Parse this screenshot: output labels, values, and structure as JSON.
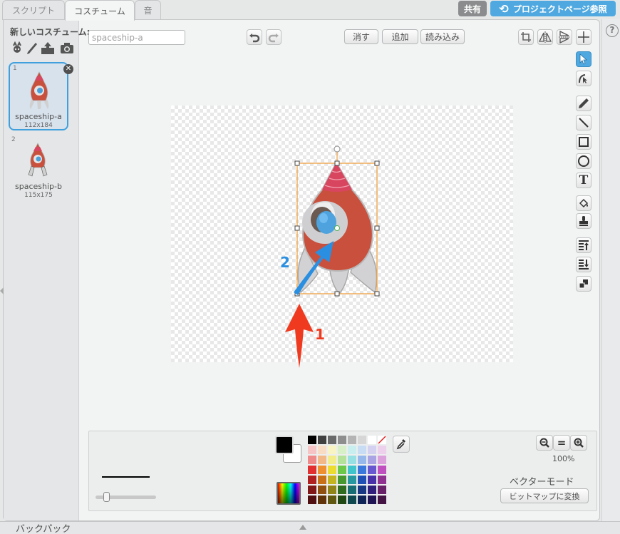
{
  "tabs": [
    {
      "label": "スクリプト"
    },
    {
      "label": "コスチューム"
    },
    {
      "label": "音"
    }
  ],
  "top_buttons": {
    "share": "共有",
    "project_page": "プロジェクトページ参照"
  },
  "sidebar": {
    "new_costume_label": "新しいコスチューム:",
    "costumes": [
      {
        "number": "1",
        "name": "spaceship-a",
        "size": "112x184"
      },
      {
        "number": "2",
        "name": "spaceship-b",
        "size": "115x175"
      }
    ]
  },
  "editor": {
    "costume_name": "spaceship-a",
    "clear_label": "消す",
    "add_label": "追加",
    "import_label": "読み込み",
    "zoom_level": "100%",
    "mode_label": "ベクターモード",
    "convert_label": "ビットマップに変換",
    "line_width_fraction": 0.15
  },
  "annotations": {
    "arrow1_label": "1",
    "arrow2_label": "2",
    "arrow1_color": "#f03a1f",
    "arrow2_color": "#2a8fe0"
  },
  "backpack_label": "バックパック",
  "help_label": "?",
  "palette_colors": [
    "#000000",
    "#404040",
    "#6a6a6a",
    "#8e8e8e",
    "#b4b4b4",
    "#d6d6d6",
    "#ffffff",
    "none",
    "#f6c4c4",
    "#f8dcc4",
    "#f8f4c4",
    "#d8f0c8",
    "#c8eef0",
    "#c8dcf4",
    "#d4d0f0",
    "#ecd0ec",
    "#ee8a8a",
    "#f2b888",
    "#f2ec8a",
    "#b4e29a",
    "#96e0e4",
    "#96b8ea",
    "#aaa4e4",
    "#dca2dc",
    "#e23030",
    "#ee9030",
    "#ecdc30",
    "#6cc848",
    "#40c4cc",
    "#3a78dc",
    "#6858d0",
    "#c050c0",
    "#b02020",
    "#c87018",
    "#c4b420",
    "#489830",
    "#2898a0",
    "#2050b4",
    "#4830a8",
    "#903090",
    "#801818",
    "#905010",
    "#908418",
    "#306c20",
    "#186c74",
    "#183884",
    "#30207c",
    "#682068",
    "#501010",
    "#603408",
    "#605810",
    "#204814",
    "#104850",
    "#102458",
    "#201454",
    "#441444"
  ]
}
